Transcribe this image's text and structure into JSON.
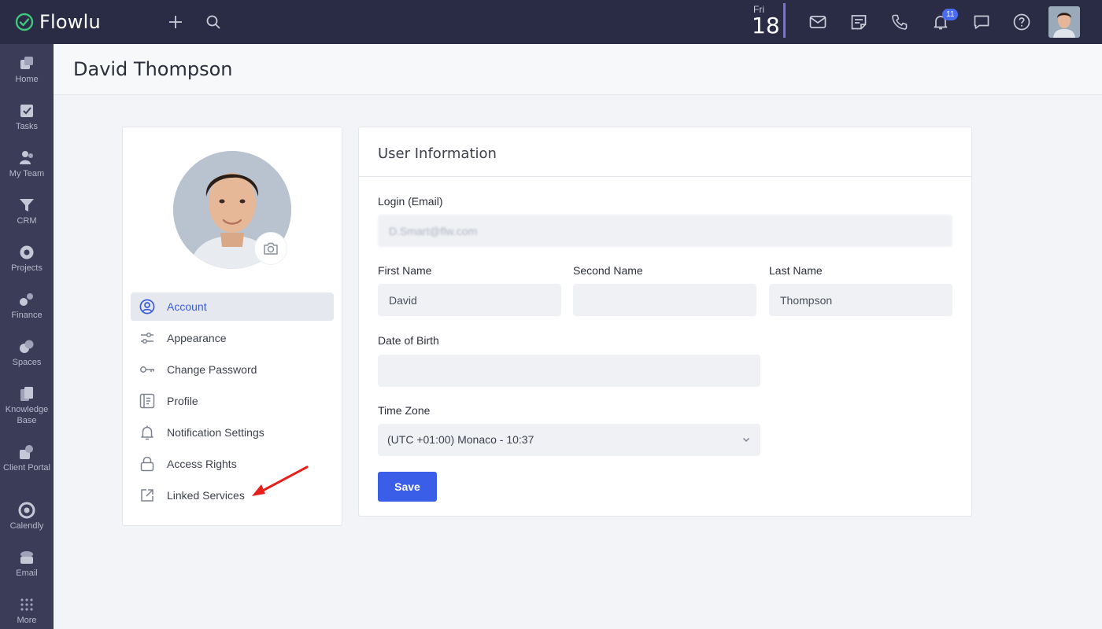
{
  "app": {
    "name": "Flowlu"
  },
  "topbar": {
    "date_day": "Fri",
    "date_num": "18",
    "notification_count": "11"
  },
  "sidebar": {
    "items": [
      {
        "label": "Home",
        "icon": "home-icon"
      },
      {
        "label": "Tasks",
        "icon": "tasks-icon"
      },
      {
        "label": "My Team",
        "icon": "team-icon"
      },
      {
        "label": "CRM",
        "icon": "crm-icon"
      },
      {
        "label": "Projects",
        "icon": "projects-icon"
      },
      {
        "label": "Finance",
        "icon": "finance-icon"
      },
      {
        "label": "Spaces",
        "icon": "spaces-icon"
      },
      {
        "label": "Knowledge Base",
        "icon": "knowledge-base-icon"
      },
      {
        "label": "Client Portal",
        "icon": "client-portal-icon"
      },
      {
        "label": "Calendly",
        "icon": "calendly-icon"
      },
      {
        "label": "Email",
        "icon": "email-icon"
      },
      {
        "label": "More",
        "icon": "more-icon"
      }
    ]
  },
  "page": {
    "title": "David Thompson"
  },
  "settings_menu": {
    "items": [
      {
        "label": "Account",
        "icon": "account-icon",
        "active": true
      },
      {
        "label": "Appearance",
        "icon": "sliders-icon"
      },
      {
        "label": "Change Password",
        "icon": "key-icon"
      },
      {
        "label": "Profile",
        "icon": "profile-icon"
      },
      {
        "label": "Notification Settings",
        "icon": "bell-icon"
      },
      {
        "label": "Access Rights",
        "icon": "lock-icon"
      },
      {
        "label": "Linked Services",
        "icon": "external-link-icon"
      }
    ]
  },
  "user_info": {
    "title": "User Information",
    "login_label": "Login (Email)",
    "login_value": "D.Smart@flw.com",
    "first_name_label": "First Name",
    "first_name_value": "David",
    "second_name_label": "Second Name",
    "second_name_value": "",
    "last_name_label": "Last Name",
    "last_name_value": "Thompson",
    "dob_label": "Date of Birth",
    "dob_value": "",
    "timezone_label": "Time Zone",
    "timezone_value": "(UTC +01:00) Monaco - 10:37",
    "save_label": "Save"
  },
  "colors": {
    "topbar": "#2a2b45",
    "sidebar": "#3b3c58",
    "accent": "#3b5ee8",
    "annotation_arrow": "#e8201c"
  }
}
